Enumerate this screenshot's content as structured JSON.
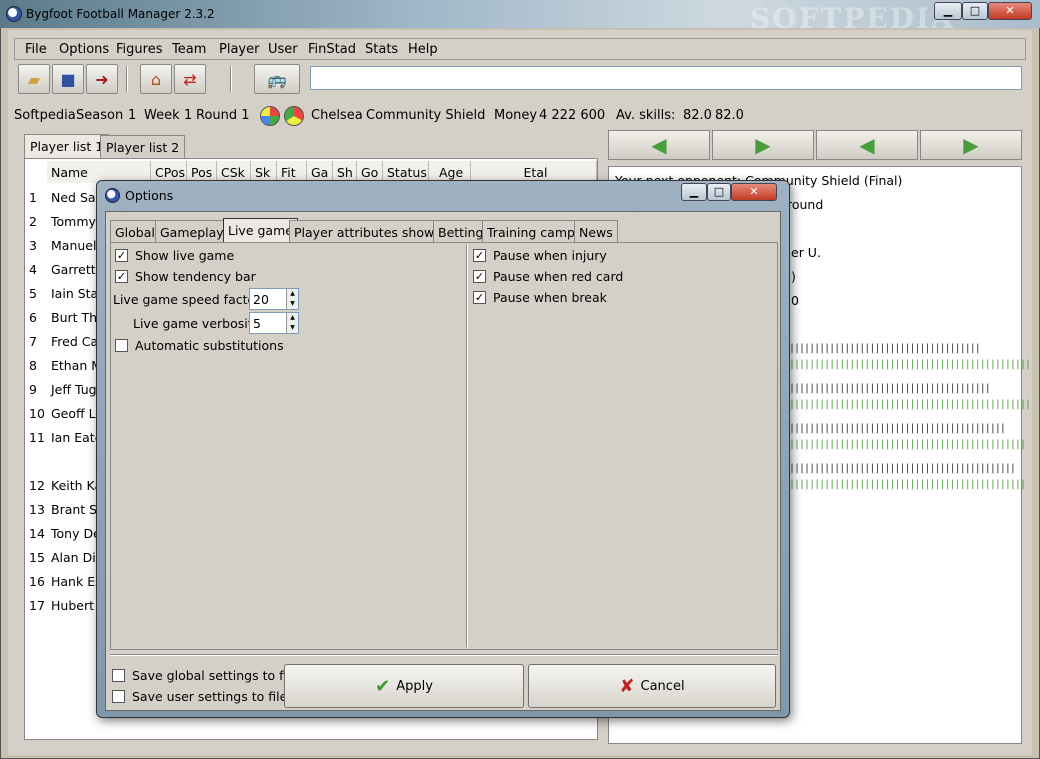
{
  "window": {
    "title": "Bygfoot Football Manager 2.3.2",
    "min": "▁",
    "max": "□",
    "close": "✕",
    "watermark": "SOFTPEDIA"
  },
  "menu": [
    "File",
    "Options",
    "Figures",
    "Team",
    "Player",
    "User",
    "FinStad",
    "Stats",
    "Help"
  ],
  "toolbar": {
    "entry_value": ""
  },
  "status": {
    "user": "Softpedia",
    "season_label": "Season",
    "season": "1",
    "week_label": "Week",
    "week": "1",
    "round": "Round 1",
    "team": "Chelsea",
    "competition": "Community Shield",
    "money_label": "Money",
    "money": "4 222 600",
    "skills_label": "Av. skills:",
    "skill1": "82.0",
    "skill2": "82.0"
  },
  "left_tabs": [
    "Player list 1",
    "Player list 2"
  ],
  "columns": [
    "Name",
    "CPos",
    "Pos",
    "CSk",
    "Sk",
    "Fit",
    "Ga",
    "Sh",
    "Go",
    "Status",
    "Age",
    "Etal"
  ],
  "players": [
    {
      "n": "1",
      "name": "Ned Sag"
    },
    {
      "n": "2",
      "name": "Tommy"
    },
    {
      "n": "3",
      "name": "Manuel"
    },
    {
      "n": "4",
      "name": "Garrett"
    },
    {
      "n": "5",
      "name": "Iain Sta"
    },
    {
      "n": "6",
      "name": "Burt Tho"
    },
    {
      "n": "7",
      "name": "Fred Ca"
    },
    {
      "n": "8",
      "name": "Ethan M"
    },
    {
      "n": "9",
      "name": "Jeff Tug"
    },
    {
      "n": "10",
      "name": "Geoff La"
    },
    {
      "n": "11",
      "name": "Ian Eato"
    },
    {
      "n": "12",
      "name": "Keith Ka"
    },
    {
      "n": "13",
      "name": "Brant St"
    },
    {
      "n": "14",
      "name": "Tony De"
    },
    {
      "n": "15",
      "name": "Alan Dil"
    },
    {
      "n": "16",
      "name": "Hank Es"
    },
    {
      "n": "17",
      "name": "Hubert T"
    }
  ],
  "right": {
    "next_opponent": "Your next opponent: Community Shield (Final)",
    "line2": "round",
    "line3": "er U.",
    "line4": ")",
    "line5": "0"
  },
  "dialog": {
    "title": "Options",
    "tabs": [
      "Global",
      "Gameplay",
      "Live game",
      "Player attributes shown",
      "Betting",
      "Training camp",
      "News"
    ],
    "active_tab": "Live game",
    "left": {
      "show_live_game": "Show live game",
      "show_tendency_bar": "Show tendency bar",
      "speed_label": "Live game speed factor",
      "speed_value": "20",
      "verbosity_label": "Live game verbosity",
      "verbosity_value": "5",
      "auto_subs": "Automatic substitutions"
    },
    "right": {
      "pause_injury": "Pause when injury",
      "pause_red": "Pause when red card",
      "pause_break": "Pause when break"
    },
    "save_global": "Save global settings to file",
    "save_user": "Save user settings to file",
    "apply": "Apply",
    "cancel": "Cancel"
  }
}
